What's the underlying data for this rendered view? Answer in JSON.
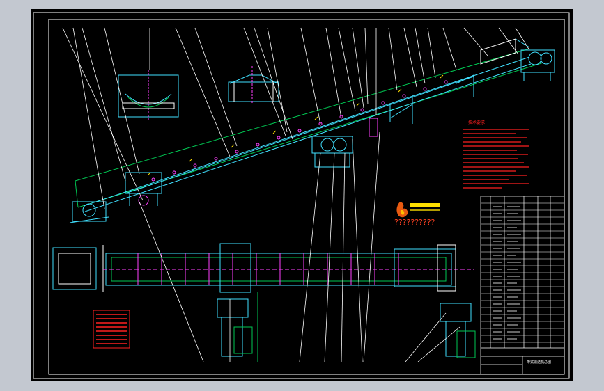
{
  "app": {
    "viewport_color": "#c3c8d0",
    "drawing_background": "#000000"
  },
  "colors": {
    "frame": "#ffffff",
    "structure": "#00c853",
    "component_cyan": "#40e0ff",
    "component_magenta": "#ff40ff",
    "leader": "#ffffff",
    "notes": "#ff2020",
    "accent_yellow": "#ffe000",
    "table": "#ffffff"
  },
  "notes": {
    "title": "技术要求"
  },
  "logo": {
    "caption": "??????????"
  },
  "title_block": {
    "drawing_name": "带式输送机总图"
  },
  "icons": {
    "logo_mark": "flame-logo-icon"
  }
}
